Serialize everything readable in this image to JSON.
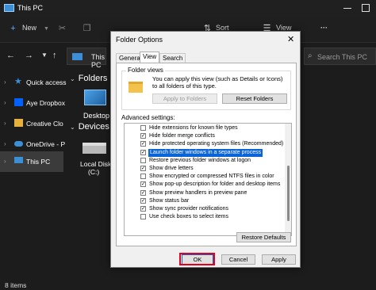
{
  "explorer": {
    "title": "This PC",
    "toolbar": {
      "new_label": "New",
      "sort_label": "Sort",
      "view_label": "View",
      "more_label": "···"
    },
    "address": {
      "path_label": "This PC",
      "search_placeholder": "Search This PC"
    },
    "sidebar": {
      "items": [
        {
          "label": "Quick access",
          "icon": "star-icon"
        },
        {
          "label": "Aye Dropbox",
          "icon": "dropbox-icon"
        },
        {
          "label": "Creative Clo",
          "icon": "folder-icon"
        },
        {
          "label": "OneDrive - P",
          "icon": "cloud-icon"
        },
        {
          "label": "This PC",
          "icon": "computer-icon"
        }
      ]
    },
    "main": {
      "folders_heading": "Folders (",
      "desktop_label": "Desktop",
      "devices_heading": "Devices a",
      "disk_label_line1": "Local Disk",
      "disk_label_line2": "(C:)"
    },
    "status": {
      "items_count": "8 items"
    }
  },
  "dialog": {
    "title": "Folder Options",
    "close_label": "✕",
    "tabs": [
      "General",
      "View",
      "Search"
    ],
    "active_tab": "View",
    "folder_views": {
      "label": "Folder views",
      "description": "You can apply this view (such as Details or Icons) to all folders of this type.",
      "apply_button": "Apply to Folders",
      "reset_button": "Reset Folders"
    },
    "advanced_label": "Advanced settings:",
    "advanced_items": [
      {
        "label": "Hide extensions for known file types",
        "checked": false
      },
      {
        "label": "Hide folder merge conflicts",
        "checked": true
      },
      {
        "label": "Hide protected operating system files (Recommended)",
        "checked": true
      },
      {
        "label": "Launch folder windows in a separate process",
        "checked": true,
        "selected": true
      },
      {
        "label": "Restore previous folder windows at logon",
        "checked": false
      },
      {
        "label": "Show drive letters",
        "checked": true
      },
      {
        "label": "Show encrypted or compressed NTFS files in color",
        "checked": false
      },
      {
        "label": "Show pop-up description for folder and desktop items",
        "checked": true
      },
      {
        "label": "Show preview handlers in preview pane",
        "checked": true
      },
      {
        "label": "Show status bar",
        "checked": true
      },
      {
        "label": "Show sync provider notifications",
        "checked": true
      },
      {
        "label": "Use check boxes to select items",
        "checked": false
      }
    ],
    "restore_defaults": "Restore Defaults",
    "ok_label": "OK",
    "cancel_label": "Cancel",
    "apply_label": "Apply",
    "highlight_color": "#e3001b",
    "selection_color": "#0a64d6"
  }
}
